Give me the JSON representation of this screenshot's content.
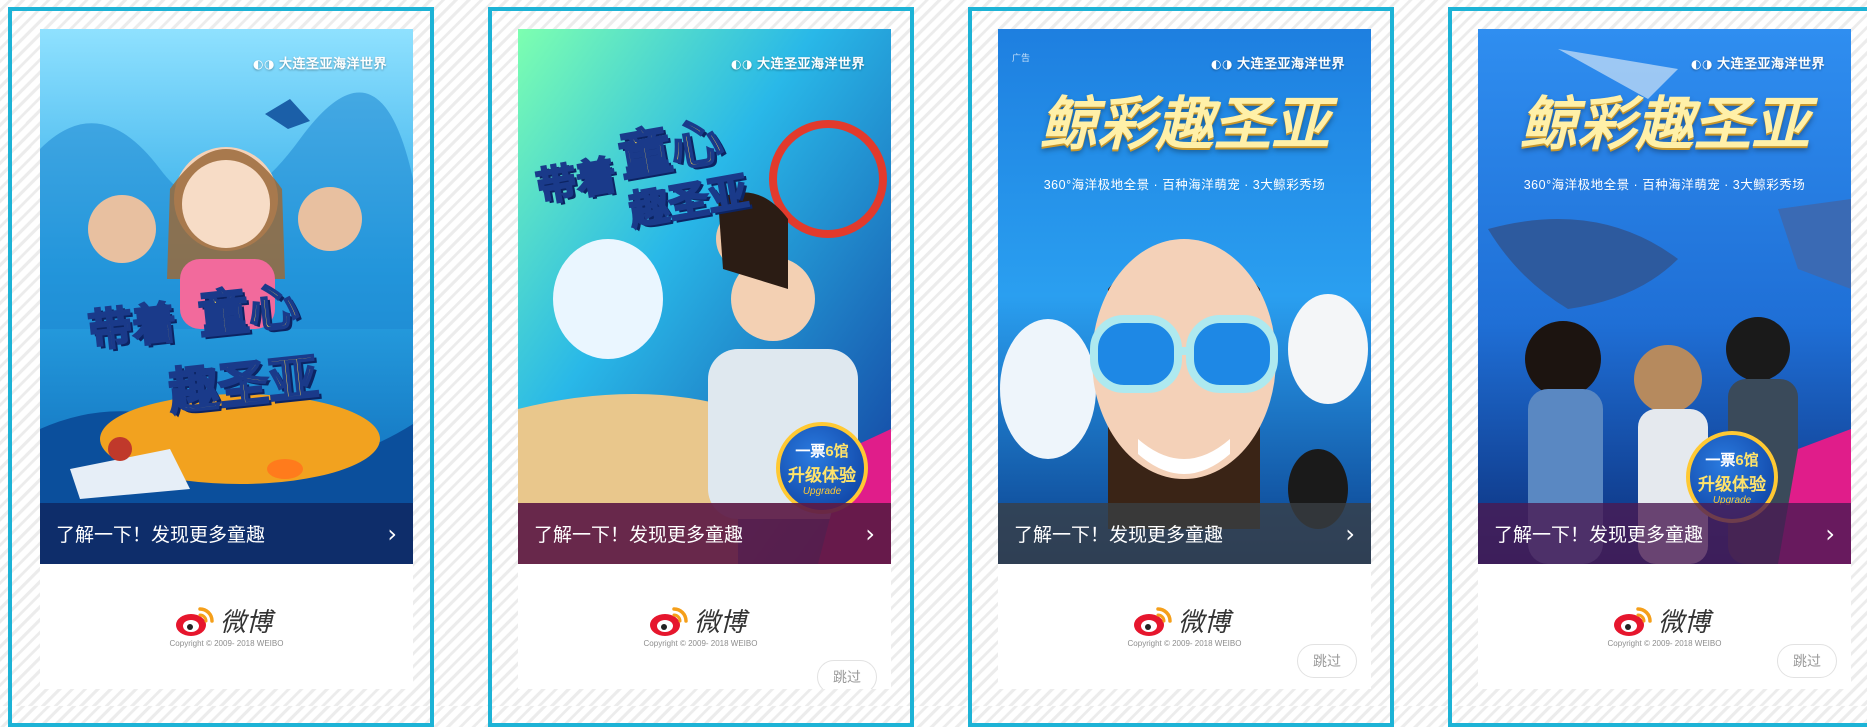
{
  "cards": [
    {
      "brand": "大连圣亚海洋世界",
      "headline": [
        "带着",
        "童心",
        "趣圣亚"
      ],
      "cta": "了解一下！发现更多童趣",
      "logo_text": "微博",
      "copyright": "Copyright © 2009- 2018 WEIBO"
    },
    {
      "brand": "大连圣亚海洋世界",
      "headline": [
        "带着",
        "童心",
        "趣圣亚"
      ],
      "badge": [
        "一票",
        "6馆",
        "升级体验",
        "Upgrade"
      ],
      "cta": "了解一下！发现更多童趣",
      "logo_text": "微博",
      "copyright": "Copyright © 2009- 2018 WEIBO",
      "skip": "跳过"
    },
    {
      "ad_tag": "广告",
      "brand": "大连圣亚海洋世界",
      "headline": "鲸彩趣圣亚",
      "subtitle": "360°海洋极地全景 · 百种海洋萌宠 · 3大鲸彩秀场",
      "cta": "了解一下！发现更多童趣",
      "logo_text": "微博",
      "copyright": "Copyright © 2009- 2018 WEIBO",
      "skip": "跳过"
    },
    {
      "brand": "大连圣亚海洋世界",
      "headline": "鲸彩趣圣亚",
      "subtitle": "360°海洋极地全景 · 百种海洋萌宠 · 3大鲸彩秀场",
      "badge": [
        "一票",
        "6馆",
        "升级体验",
        "Upgrade"
      ],
      "cta": "了解一下！发现更多童趣",
      "logo_text": "微博",
      "copyright": "Copyright © 2009- 2018 WEIBO",
      "skip": "跳过"
    }
  ],
  "colors": {
    "frame_border": "#1db3d6",
    "cta_bar_1": "#0f2a66",
    "cta_bar_2": "#5c1a45",
    "cta_bar_3": "#3a3f44",
    "cta_bar_4": "#4a1a52",
    "weibo_red": "#e6162d",
    "weibo_orange": "#f59f1a"
  }
}
